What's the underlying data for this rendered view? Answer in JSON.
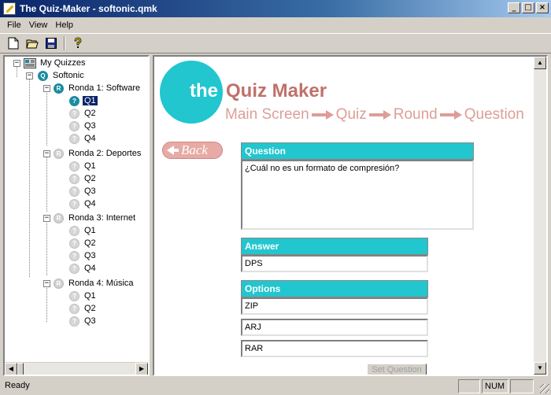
{
  "window": {
    "title": "The Quiz-Maker - softonic.qmk",
    "minimize": "_",
    "maximize": "□",
    "close": "×"
  },
  "menu": {
    "items": [
      "File",
      "View",
      "Help"
    ]
  },
  "toolbar": {
    "buttons": [
      "new-icon",
      "open-icon",
      "save-icon",
      "help-icon"
    ]
  },
  "tree": {
    "root": "My Quizzes",
    "quiz": "Softonic",
    "rounds": [
      {
        "label": "Ronda 1: Software",
        "questions": [
          "Q1",
          "Q2",
          "Q3",
          "Q4"
        ]
      },
      {
        "label": "Ronda 2: Deportes",
        "questions": [
          "Q1",
          "Q2",
          "Q3",
          "Q4"
        ]
      },
      {
        "label": "Ronda 3: Internet",
        "questions": [
          "Q1",
          "Q2",
          "Q3",
          "Q4"
        ]
      },
      {
        "label": "Ronda 4: Música",
        "questions": [
          "Q1",
          "Q2",
          "Q3"
        ]
      }
    ],
    "selected": "Q1"
  },
  "logo": {
    "the": "the",
    "quiz_maker": "Quiz Maker"
  },
  "breadcrumb": {
    "items": [
      "Main Screen",
      "Quiz",
      "Round",
      "Question"
    ]
  },
  "back_label": "Back",
  "question": {
    "header": "Question",
    "text": "¿Cuál no es un formato de compresión?"
  },
  "answer": {
    "header": "Answer",
    "value": "DPS"
  },
  "options": {
    "header": "Options",
    "values": [
      "ZIP",
      "ARJ",
      "RAR"
    ]
  },
  "set_question_label": "Set Question",
  "status": {
    "text": "Ready",
    "num": "NUM"
  },
  "colors": {
    "accent": "#21c6cf",
    "logo_text": "#c0716a",
    "breadcrumb": "#dd9e97",
    "back_button": "#e7aaa4"
  }
}
